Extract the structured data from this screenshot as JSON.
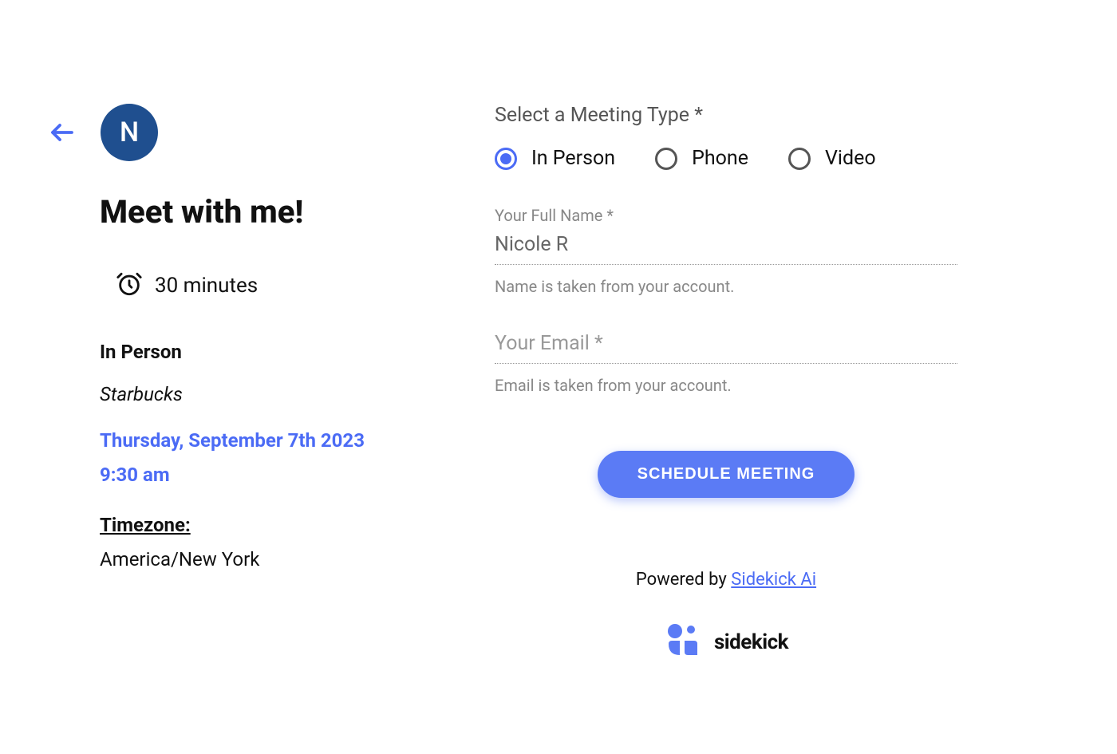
{
  "left": {
    "avatar_initial": "N",
    "title": "Meet with me!",
    "duration": "30 minutes",
    "meeting_type": "In Person",
    "location": "Starbucks",
    "date": "Thursday, September 7th 2023",
    "time": "9:30 am",
    "timezone_label": "Timezone:",
    "timezone_value": "America/New York"
  },
  "form": {
    "meeting_type_label": "Select a Meeting Type *",
    "options": {
      "in_person": "In Person",
      "phone": "Phone",
      "video": "Video"
    },
    "name_label": "Your Full Name *",
    "name_value": "Nicole R",
    "name_helper": "Name is taken from your account.",
    "email_placeholder": "Your Email *",
    "email_helper": "Email is taken from your account.",
    "submit_label": "SCHEDULE MEETING"
  },
  "footer": {
    "powered_by_prefix": "Powered by ",
    "powered_by_link": "Sidekick Ai",
    "logo_text": "sidekick"
  }
}
